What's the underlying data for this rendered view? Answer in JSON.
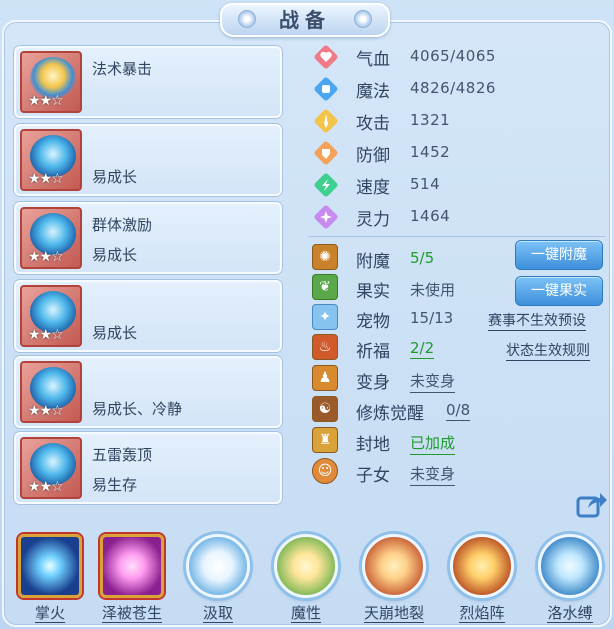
{
  "title": "战备",
  "cards": [
    {
      "line1": "法术暴击",
      "line2": "",
      "stars": "★★☆",
      "icon": "golden-dragon-helm-icon"
    },
    {
      "line1": "",
      "line2": "易成长",
      "stars": "★★☆",
      "icon": "blue-guardian-icon"
    },
    {
      "line1": "群体激励",
      "line2": "易成长",
      "stars": "★★☆",
      "icon": "blue-warrior-icon"
    },
    {
      "line1": "",
      "line2": "易成长",
      "stars": "★★☆",
      "icon": "blue-horned-helm-icon"
    },
    {
      "line1": "",
      "line2": "易成长、冷静",
      "stars": "★★☆",
      "icon": "blue-crown-icon"
    },
    {
      "line1": "五雷轰顶",
      "line2": "易生存",
      "stars": "★★☆",
      "icon": "blue-flame-helm-icon"
    }
  ],
  "attributes": [
    {
      "label": "气血",
      "value": "4065/4065",
      "icon": "heart-icon",
      "color": "#f07a86"
    },
    {
      "label": "魔法",
      "value": "4826/4826",
      "icon": "mana-drop-icon",
      "color": "#4aa6f0"
    },
    {
      "label": "攻击",
      "value": "1321",
      "icon": "sword-icon",
      "color": "#f2c44a"
    },
    {
      "label": "防御",
      "value": "1452",
      "icon": "shield-icon",
      "color": "#f4a25a"
    },
    {
      "label": "速度",
      "value": "514",
      "icon": "speed-icon",
      "color": "#3fcf8f"
    },
    {
      "label": "灵力",
      "value": "1464",
      "icon": "spirit-icon",
      "color": "#c68af0"
    }
  ],
  "extras": [
    {
      "label": "附魔",
      "value": "5/5",
      "green": true,
      "link": false,
      "icon": "enchant-icon",
      "color": "#c9822a"
    },
    {
      "label": "果实",
      "value": "未使用",
      "green": false,
      "link": false,
      "icon": "fruit-icon",
      "color": "#5aa84a"
    },
    {
      "label": "宠物",
      "value": "15/13",
      "green": false,
      "link": false,
      "icon": "pet-icon",
      "color": "#86c3ef"
    },
    {
      "label": "祈福",
      "value": "2/2",
      "green": true,
      "link": true,
      "icon": "blessing-icon",
      "color": "#d05a2a"
    },
    {
      "label": "变身",
      "value": "未变身",
      "green": false,
      "link": true,
      "icon": "transform-icon",
      "color": "#d88a2e"
    },
    {
      "label": "修炼觉醒",
      "value": "0/8",
      "green": false,
      "link": true,
      "icon": "cultivation-icon",
      "color": "#9a5a2a"
    },
    {
      "label": "封地",
      "value": "已加成",
      "green": true,
      "link": true,
      "icon": "fief-icon",
      "color": "#d9a33a"
    },
    {
      "label": "子女",
      "value": "未变身",
      "green": false,
      "link": true,
      "icon": "child-icon",
      "color": "#e08a3a"
    }
  ],
  "buttons": {
    "enchant_all": "一键附魔",
    "fruit_all": "一键果实"
  },
  "links": {
    "tournament": "赛事不生效预设",
    "status_rules": "状态生效规则"
  },
  "skills": [
    {
      "label": "掌火",
      "shape": "square",
      "icon": "palm-fire-icon",
      "c1": "#8fe0ff",
      "c2": "#1a3f8f"
    },
    {
      "label": "泽被苍生",
      "shape": "square",
      "icon": "blessing-hand-icon",
      "c1": "#ff9cf0",
      "c2": "#8a1f8f"
    },
    {
      "label": "汲取",
      "shape": "ring",
      "icon": "absorb-icon",
      "c1": "#e8f4ff",
      "c2": "#5aa8e0"
    },
    {
      "label": "魔性",
      "shape": "ring",
      "icon": "demon-nature-icon",
      "c1": "#ffe69a",
      "c2": "#6ab04a"
    },
    {
      "label": "天崩地裂",
      "shape": "ring",
      "icon": "earthquake-icon",
      "c1": "#ffd28a",
      "c2": "#c0502a"
    },
    {
      "label": "烈焰阵",
      "shape": "ring",
      "icon": "flame-formation-icon",
      "c1": "#ffcf6a",
      "c2": "#b0401a"
    },
    {
      "label": "洛水缚",
      "shape": "ring",
      "icon": "water-bind-icon",
      "c1": "#bfe8ff",
      "c2": "#2a7ac0"
    }
  ]
}
